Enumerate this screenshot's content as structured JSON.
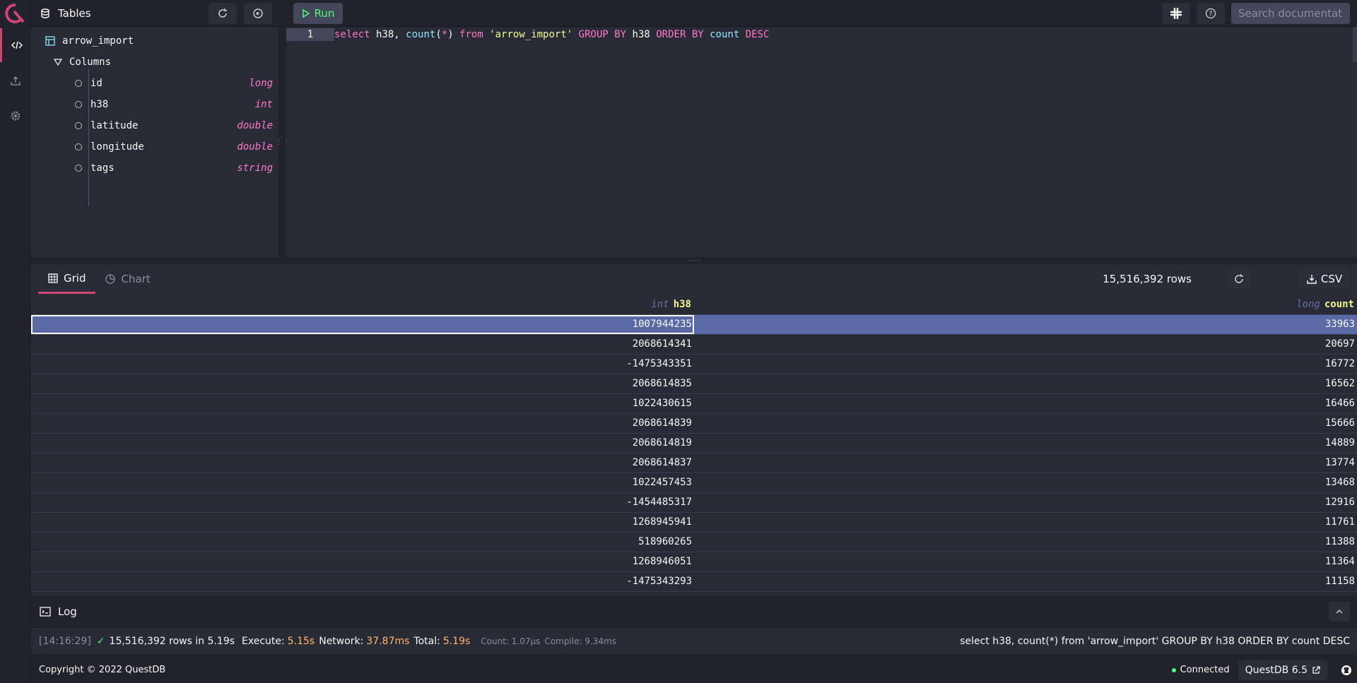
{
  "topbar": {
    "tables_label": "Tables",
    "run_label": "Run",
    "search_placeholder": "Search documentation"
  },
  "schema": {
    "table_name": "arrow_import",
    "columns_label": "Columns",
    "columns": [
      {
        "name": "id",
        "type": "long"
      },
      {
        "name": "h38",
        "type": "int"
      },
      {
        "name": "latitude",
        "type": "double"
      },
      {
        "name": "longitude",
        "type": "double"
      },
      {
        "name": "tags",
        "type": "string"
      }
    ]
  },
  "editor": {
    "line_number": "1",
    "tokens": {
      "select": "select",
      "col1": " h38, ",
      "count": "count",
      "paren_open": "(",
      "star": "*",
      "paren_close": ") ",
      "from": "from",
      "space1": " ",
      "table": "'arrow_import'",
      "space2": " ",
      "groupby": "GROUP BY",
      "col2": " h38 ",
      "orderby": "ORDER BY",
      "col3": " count ",
      "desc": "DESC"
    }
  },
  "results": {
    "tabs": [
      {
        "label": "Grid"
      },
      {
        "label": "Chart"
      }
    ],
    "row_count": "15,516,392 rows",
    "csv_label": "CSV",
    "headers": [
      {
        "type": "int",
        "name": "h38"
      },
      {
        "type": "long",
        "name": "count"
      }
    ],
    "rows": [
      [
        "1007944235",
        "33963"
      ],
      [
        "2068614341",
        "20697"
      ],
      [
        "-1475343351",
        "16772"
      ],
      [
        "2068614835",
        "16562"
      ],
      [
        "1022430615",
        "16466"
      ],
      [
        "2068614839",
        "15666"
      ],
      [
        "2068614819",
        "14889"
      ],
      [
        "2068614837",
        "13774"
      ],
      [
        "1022457453",
        "13468"
      ],
      [
        "-1454485317",
        "12916"
      ],
      [
        "1268945941",
        "11761"
      ],
      [
        "518960265",
        "11388"
      ],
      [
        "1268946051",
        "11364"
      ],
      [
        "-1475343293",
        "11158"
      ]
    ]
  },
  "log": {
    "label": "Log",
    "timestamp": "[14:16:29]",
    "summary": "15,516,392 rows in 5.19s",
    "execute_label": "Execute:",
    "execute_value": "5.15s",
    "network_label": "Network:",
    "network_value": "37.87ms",
    "total_label": "Total:",
    "total_value": "5.19s",
    "count_text": "Count: 1.07μs",
    "compile_text": "Compile: 9.34ms",
    "query": "select h38, count(*) from 'arrow_import' GROUP BY h38 ORDER BY count DESC"
  },
  "footer": {
    "copyright": "Copyright © 2022 QuestDB",
    "status": "Connected",
    "version": "QuestDB 6.5"
  },
  "colors": {
    "accent": "#d14671",
    "background": "#21222c",
    "panel": "#282a36",
    "keyword": "#ff79c6",
    "string": "#f1fa8c",
    "function": "#8be9fd",
    "success": "#50fa7b",
    "selection": "#5b6aa6"
  }
}
